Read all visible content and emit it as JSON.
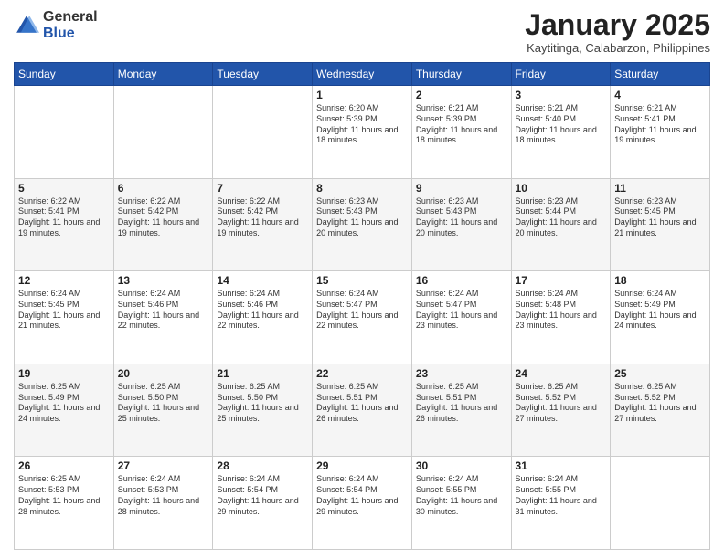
{
  "logo": {
    "general": "General",
    "blue": "Blue"
  },
  "header": {
    "month": "January 2025",
    "location": "Kaytitinga, Calabarzon, Philippines"
  },
  "days": [
    "Sunday",
    "Monday",
    "Tuesday",
    "Wednesday",
    "Thursday",
    "Friday",
    "Saturday"
  ],
  "weeks": [
    [
      {
        "day": "",
        "sunrise": "",
        "sunset": "",
        "daylight": ""
      },
      {
        "day": "",
        "sunrise": "",
        "sunset": "",
        "daylight": ""
      },
      {
        "day": "",
        "sunrise": "",
        "sunset": "",
        "daylight": ""
      },
      {
        "day": "1",
        "sunrise": "Sunrise: 6:20 AM",
        "sunset": "Sunset: 5:39 PM",
        "daylight": "Daylight: 11 hours and 18 minutes."
      },
      {
        "day": "2",
        "sunrise": "Sunrise: 6:21 AM",
        "sunset": "Sunset: 5:39 PM",
        "daylight": "Daylight: 11 hours and 18 minutes."
      },
      {
        "day": "3",
        "sunrise": "Sunrise: 6:21 AM",
        "sunset": "Sunset: 5:40 PM",
        "daylight": "Daylight: 11 hours and 18 minutes."
      },
      {
        "day": "4",
        "sunrise": "Sunrise: 6:21 AM",
        "sunset": "Sunset: 5:41 PM",
        "daylight": "Daylight: 11 hours and 19 minutes."
      }
    ],
    [
      {
        "day": "5",
        "sunrise": "Sunrise: 6:22 AM",
        "sunset": "Sunset: 5:41 PM",
        "daylight": "Daylight: 11 hours and 19 minutes."
      },
      {
        "day": "6",
        "sunrise": "Sunrise: 6:22 AM",
        "sunset": "Sunset: 5:42 PM",
        "daylight": "Daylight: 11 hours and 19 minutes."
      },
      {
        "day": "7",
        "sunrise": "Sunrise: 6:22 AM",
        "sunset": "Sunset: 5:42 PM",
        "daylight": "Daylight: 11 hours and 19 minutes."
      },
      {
        "day": "8",
        "sunrise": "Sunrise: 6:23 AM",
        "sunset": "Sunset: 5:43 PM",
        "daylight": "Daylight: 11 hours and 20 minutes."
      },
      {
        "day": "9",
        "sunrise": "Sunrise: 6:23 AM",
        "sunset": "Sunset: 5:43 PM",
        "daylight": "Daylight: 11 hours and 20 minutes."
      },
      {
        "day": "10",
        "sunrise": "Sunrise: 6:23 AM",
        "sunset": "Sunset: 5:44 PM",
        "daylight": "Daylight: 11 hours and 20 minutes."
      },
      {
        "day": "11",
        "sunrise": "Sunrise: 6:23 AM",
        "sunset": "Sunset: 5:45 PM",
        "daylight": "Daylight: 11 hours and 21 minutes."
      }
    ],
    [
      {
        "day": "12",
        "sunrise": "Sunrise: 6:24 AM",
        "sunset": "Sunset: 5:45 PM",
        "daylight": "Daylight: 11 hours and 21 minutes."
      },
      {
        "day": "13",
        "sunrise": "Sunrise: 6:24 AM",
        "sunset": "Sunset: 5:46 PM",
        "daylight": "Daylight: 11 hours and 22 minutes."
      },
      {
        "day": "14",
        "sunrise": "Sunrise: 6:24 AM",
        "sunset": "Sunset: 5:46 PM",
        "daylight": "Daylight: 11 hours and 22 minutes."
      },
      {
        "day": "15",
        "sunrise": "Sunrise: 6:24 AM",
        "sunset": "Sunset: 5:47 PM",
        "daylight": "Daylight: 11 hours and 22 minutes."
      },
      {
        "day": "16",
        "sunrise": "Sunrise: 6:24 AM",
        "sunset": "Sunset: 5:47 PM",
        "daylight": "Daylight: 11 hours and 23 minutes."
      },
      {
        "day": "17",
        "sunrise": "Sunrise: 6:24 AM",
        "sunset": "Sunset: 5:48 PM",
        "daylight": "Daylight: 11 hours and 23 minutes."
      },
      {
        "day": "18",
        "sunrise": "Sunrise: 6:24 AM",
        "sunset": "Sunset: 5:49 PM",
        "daylight": "Daylight: 11 hours and 24 minutes."
      }
    ],
    [
      {
        "day": "19",
        "sunrise": "Sunrise: 6:25 AM",
        "sunset": "Sunset: 5:49 PM",
        "daylight": "Daylight: 11 hours and 24 minutes."
      },
      {
        "day": "20",
        "sunrise": "Sunrise: 6:25 AM",
        "sunset": "Sunset: 5:50 PM",
        "daylight": "Daylight: 11 hours and 25 minutes."
      },
      {
        "day": "21",
        "sunrise": "Sunrise: 6:25 AM",
        "sunset": "Sunset: 5:50 PM",
        "daylight": "Daylight: 11 hours and 25 minutes."
      },
      {
        "day": "22",
        "sunrise": "Sunrise: 6:25 AM",
        "sunset": "Sunset: 5:51 PM",
        "daylight": "Daylight: 11 hours and 26 minutes."
      },
      {
        "day": "23",
        "sunrise": "Sunrise: 6:25 AM",
        "sunset": "Sunset: 5:51 PM",
        "daylight": "Daylight: 11 hours and 26 minutes."
      },
      {
        "day": "24",
        "sunrise": "Sunrise: 6:25 AM",
        "sunset": "Sunset: 5:52 PM",
        "daylight": "Daylight: 11 hours and 27 minutes."
      },
      {
        "day": "25",
        "sunrise": "Sunrise: 6:25 AM",
        "sunset": "Sunset: 5:52 PM",
        "daylight": "Daylight: 11 hours and 27 minutes."
      }
    ],
    [
      {
        "day": "26",
        "sunrise": "Sunrise: 6:25 AM",
        "sunset": "Sunset: 5:53 PM",
        "daylight": "Daylight: 11 hours and 28 minutes."
      },
      {
        "day": "27",
        "sunrise": "Sunrise: 6:24 AM",
        "sunset": "Sunset: 5:53 PM",
        "daylight": "Daylight: 11 hours and 28 minutes."
      },
      {
        "day": "28",
        "sunrise": "Sunrise: 6:24 AM",
        "sunset": "Sunset: 5:54 PM",
        "daylight": "Daylight: 11 hours and 29 minutes."
      },
      {
        "day": "29",
        "sunrise": "Sunrise: 6:24 AM",
        "sunset": "Sunset: 5:54 PM",
        "daylight": "Daylight: 11 hours and 29 minutes."
      },
      {
        "day": "30",
        "sunrise": "Sunrise: 6:24 AM",
        "sunset": "Sunset: 5:55 PM",
        "daylight": "Daylight: 11 hours and 30 minutes."
      },
      {
        "day": "31",
        "sunrise": "Sunrise: 6:24 AM",
        "sunset": "Sunset: 5:55 PM",
        "daylight": "Daylight: 11 hours and 31 minutes."
      },
      {
        "day": "",
        "sunrise": "",
        "sunset": "",
        "daylight": ""
      }
    ]
  ]
}
